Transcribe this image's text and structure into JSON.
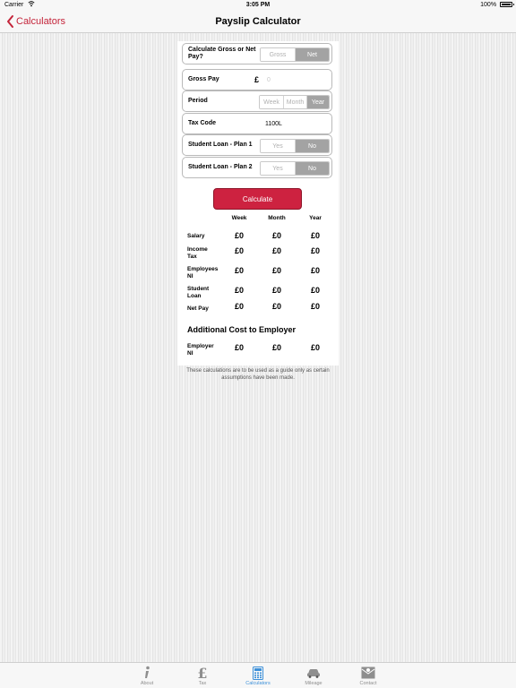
{
  "status_bar": {
    "carrier": "Carrier",
    "time": "3:05 PM",
    "battery": "100%"
  },
  "nav": {
    "back_label": "Calculators",
    "title": "Payslip Calculator"
  },
  "form": {
    "gross_or_net": {
      "label": "Calculate Gross or Net Pay?",
      "options": [
        "Gross",
        "Net"
      ],
      "selected": "Net"
    },
    "gross_pay": {
      "label": "Gross Pay",
      "currency": "£",
      "placeholder": "0",
      "value": ""
    },
    "period": {
      "label": "Period",
      "options": [
        "Week",
        "Month",
        "Year"
      ],
      "selected": "Year"
    },
    "tax_code": {
      "label": "Tax Code",
      "value": "1100L"
    },
    "student_loan_1": {
      "label": "Student Loan - Plan 1",
      "options": [
        "Yes",
        "No"
      ],
      "selected": "No"
    },
    "student_loan_2": {
      "label": "Student Loan - Plan 2",
      "options": [
        "Yes",
        "No"
      ],
      "selected": "No"
    }
  },
  "calculate_label": "Calculate",
  "results": {
    "columns": [
      "Week",
      "Month",
      "Year"
    ],
    "rows": [
      {
        "label": "Salary",
        "values": [
          "£0",
          "£0",
          "£0"
        ]
      },
      {
        "label": "Income Tax",
        "values": [
          "£0",
          "£0",
          "£0"
        ]
      },
      {
        "label": "Employees NI",
        "values": [
          "£0",
          "£0",
          "£0"
        ]
      },
      {
        "label": "Student Loan",
        "values": [
          "£0",
          "£0",
          "£0"
        ]
      },
      {
        "label": "Net Pay",
        "values": [
          "£0",
          "£0",
          "£0"
        ]
      }
    ]
  },
  "additional": {
    "title": "Additional Cost to Employer",
    "rows": [
      {
        "label": "Employer NI",
        "values": [
          "£0",
          "£0",
          "£0"
        ]
      }
    ]
  },
  "disclaimer": "These calculations are to be used as a guide only as certain assumptions have been made.",
  "tabs": [
    {
      "label": "About",
      "icon": "info-icon",
      "active": false
    },
    {
      "label": "Tax",
      "icon": "pound-icon",
      "active": false
    },
    {
      "label": "Calculators",
      "icon": "calculator-icon",
      "active": true
    },
    {
      "label": "Mileage",
      "icon": "car-icon",
      "active": false
    },
    {
      "label": "Contact",
      "icon": "envelope-icon",
      "active": false
    }
  ],
  "colors": {
    "accent": "#c4243a",
    "button": "#cd2240",
    "tab_active": "#3b8fd8",
    "segment_selected": "#a3a3a3"
  }
}
